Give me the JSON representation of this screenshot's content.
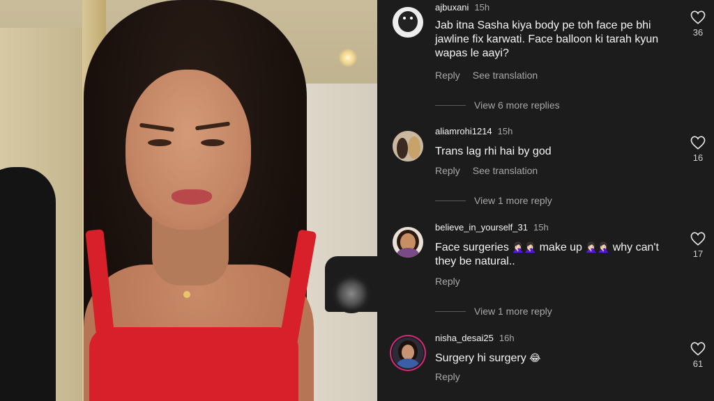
{
  "comments": [
    {
      "username": "ajbuxani",
      "time": "15h",
      "text": "Jab itna Sasha kiya body pe toh face pe bhi jawline fix karwati. Face balloon ki tarah kyun wapas le aayi?",
      "actions": {
        "reply": "Reply",
        "translate": "See translation"
      },
      "likes": "36",
      "view_more": "View 6 more replies",
      "avatar_icon": "dog-avatar"
    },
    {
      "username": "aliamrohi1214",
      "time": "15h",
      "text": "Trans lag rhi hai by god",
      "actions": {
        "reply": "Reply",
        "translate": "See translation"
      },
      "likes": "16",
      "view_more": "View 1 more reply",
      "avatar_icon": "kids-avatar"
    },
    {
      "username": "believe_in_yourself_31",
      "time": "15h",
      "text_before": "Face surgeries ",
      "emoji_1": "🤦🏻‍♀️🤦🏻‍♀️",
      "text_middle": " make up ",
      "emoji_2": "🤦🏻‍♀️🤦🏻‍♀️",
      "text_after": " why can't they be natural..",
      "actions": {
        "reply": "Reply"
      },
      "likes": "17",
      "view_more": "View 1 more reply",
      "avatar_icon": "woman-avatar"
    },
    {
      "username": "nisha_desai25",
      "time": "16h",
      "text": "Surgery hi surgery ",
      "emoji": "😂",
      "actions": {
        "reply": "Reply"
      },
      "likes": "61",
      "avatar_icon": "girl-avatar-story-ring"
    }
  ],
  "colors": {
    "panel_bg": "#1c1c1d",
    "text": "#f5f5f5",
    "muted": "#a8a8a8",
    "story_ring": "#d62976"
  }
}
